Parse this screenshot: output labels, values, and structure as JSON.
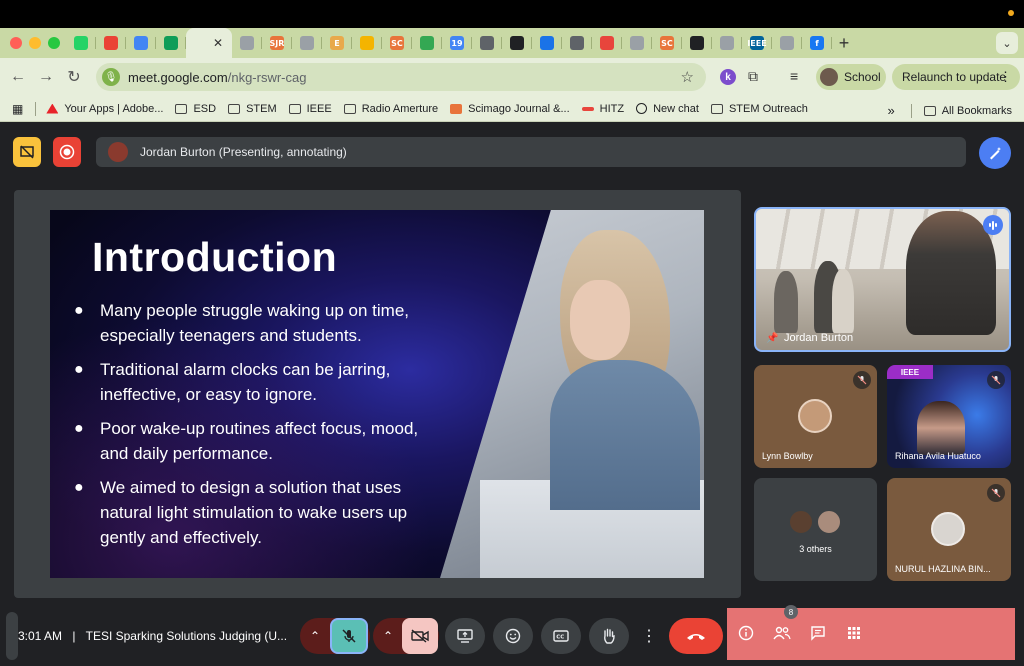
{
  "browser": {
    "tabs": [
      {
        "icon": "whatsapp-icon",
        "color": "#25d366"
      },
      {
        "icon": "gmail-icon",
        "color": "#ea4335"
      },
      {
        "icon": "google-docs-icon",
        "color": "#4285f4"
      },
      {
        "icon": "google-sheets-icon",
        "color": "#0f9d58"
      },
      {
        "icon": "meet-tab-icon",
        "color": "#e7eedb"
      },
      {
        "icon": "globe-icon",
        "color": "#9aa0a6"
      },
      {
        "icon": "sjr-icon",
        "color": "#e8743b",
        "text": "SJR"
      },
      {
        "icon": "globe-icon",
        "color": "#9aa0a6"
      },
      {
        "icon": "e-icon",
        "color": "#e8a94b",
        "text": "E"
      },
      {
        "icon": "slides-icon",
        "color": "#f4b400"
      },
      {
        "icon": "sc-icon",
        "color": "#e8743b",
        "text": "SC"
      },
      {
        "icon": "drive-icon",
        "color": "#34a853"
      },
      {
        "icon": "calendar-icon",
        "color": "#4285f4",
        "text": "19"
      },
      {
        "icon": "reader-icon",
        "color": "#5f6368"
      },
      {
        "icon": "chatgpt-icon",
        "color": "#202124"
      },
      {
        "icon": "gear-icon",
        "color": "#1a73e8"
      },
      {
        "icon": "image-icon",
        "color": "#5f6368"
      },
      {
        "icon": "hitz-icon",
        "color": "#e8453c"
      },
      {
        "icon": "globe-icon",
        "color": "#9aa0a6"
      },
      {
        "icon": "sc-icon",
        "color": "#e8743b",
        "text": "SC"
      },
      {
        "icon": "m-icon",
        "color": "#202124"
      },
      {
        "icon": "globe-icon",
        "color": "#9aa0a6"
      },
      {
        "icon": "ieee-icon",
        "color": "#00629b",
        "text": "IEEE"
      },
      {
        "icon": "globe-icon",
        "color": "#9aa0a6"
      },
      {
        "icon": "facebook-icon",
        "color": "#1877f2",
        "text": "f"
      }
    ],
    "url_host": "meet.google.com",
    "url_path": "/nkg-rswr-cag",
    "profile_name": "School",
    "relaunch_label": "Relaunch to update",
    "bookmarks": [
      {
        "label": "Your Apps | Adobe...",
        "icon": "adobe-icon"
      },
      {
        "label": "ESD",
        "icon": "folder-icon"
      },
      {
        "label": "STEM",
        "icon": "folder-icon"
      },
      {
        "label": "IEEE",
        "icon": "folder-icon"
      },
      {
        "label": "Radio Amerture",
        "icon": "folder-icon"
      },
      {
        "label": "Scimago Journal &...",
        "icon": "sjr-icon"
      },
      {
        "label": "HITZ",
        "icon": "hitz-icon"
      },
      {
        "label": "New chat",
        "icon": "chatgpt-icon"
      },
      {
        "label": "STEM Outreach",
        "icon": "folder-icon"
      }
    ],
    "bookmarks_more": "»",
    "all_bookmarks_label": "All Bookmarks"
  },
  "meet": {
    "presenting_label": "Jordan Burton (Presenting, annotating)",
    "slide": {
      "title": "Introduction",
      "bullets": [
        "Many people struggle waking up on time, especially teenagers and students.",
        "Traditional alarm clocks can be jarring, ineffective, or easy to ignore.",
        "Poor wake-up routines affect focus, mood, and daily performance.",
        "We aimed to design a solution that uses natural light stimulation to wake users up gently and effectively."
      ]
    },
    "participants": {
      "main_tile_name": "Jordan Burton",
      "tile2_name": "Lynn Bowlby",
      "tile3_name": "Rihana Avila Huatuco",
      "tile3_badge": "IEEE",
      "tile4_name": "3 others",
      "tile5_name": "NURUL HAZLINA BIN..."
    },
    "bottom": {
      "time": "3:01 AM",
      "separator": "|",
      "meeting_title": "TESI Sparking Solutions Judging (U...",
      "people_count": "8"
    },
    "colors": {
      "mic_active": "#5bbfb5",
      "camera_off": "#f5c6c2",
      "end_call": "#ea4335",
      "right_panel": "#e57373",
      "accent_blue": "#4c7ef3"
    }
  }
}
